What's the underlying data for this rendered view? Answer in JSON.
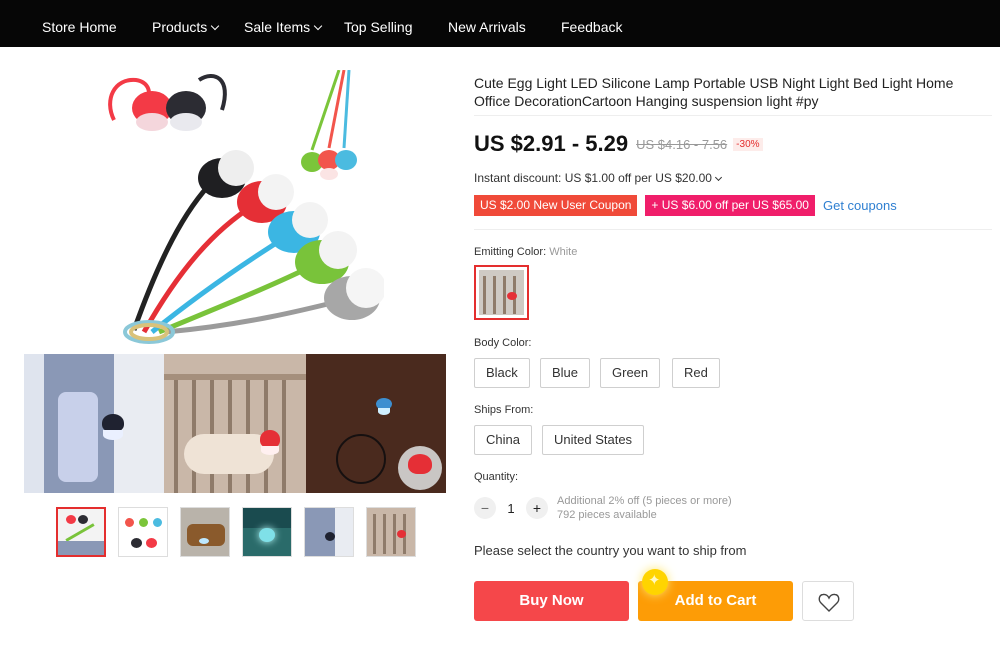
{
  "nav": {
    "items": [
      {
        "label": "Store Home",
        "dropdown": false
      },
      {
        "label": "Products",
        "dropdown": true
      },
      {
        "label": "Sale Items",
        "dropdown": true
      },
      {
        "label": "Top Selling",
        "dropdown": false
      },
      {
        "label": "New Arrivals",
        "dropdown": false
      },
      {
        "label": "Feedback",
        "dropdown": false
      }
    ]
  },
  "product": {
    "title": "Cute Egg Light LED Silicone Lamp Portable USB Night Light Bed Light Home Office DecorationCartoon Hanging suspension light #py",
    "price": "US $2.91 - 5.29",
    "old_price": "US $4.16 - 7.56",
    "discount": "-30%",
    "instant_discount": "Instant discount: US $1.00 off per US $20.00",
    "coupons": [
      "US $2.00 New User Coupon",
      "+ US $6.00 off per US $65.00"
    ],
    "get_coupons": "Get coupons"
  },
  "options": {
    "emitting_label": "Emitting Color:",
    "emitting_value": "White",
    "body_label": "Body Color:",
    "body_colors": [
      "Black",
      "Blue",
      "Green",
      "Red"
    ],
    "ships_label": "Ships From:",
    "ships_from": [
      "China",
      "United States"
    ]
  },
  "quantity": {
    "label": "Quantity:",
    "minus": "−",
    "value": "1",
    "plus": "+",
    "discount_note": "Additional 2% off (5 pieces or more)",
    "available": "792 pieces available"
  },
  "ship_message": "Please select the country you want to ship from",
  "actions": {
    "buy_now": "Buy Now",
    "add_to_cart": "Add to Cart",
    "wishlist_icon": "heart-icon"
  },
  "colors": {
    "accent_red": "#e42e2e",
    "buy_now": "#f5474a",
    "add_to_cart": "#fd9c06",
    "link": "#2e7fd1"
  }
}
